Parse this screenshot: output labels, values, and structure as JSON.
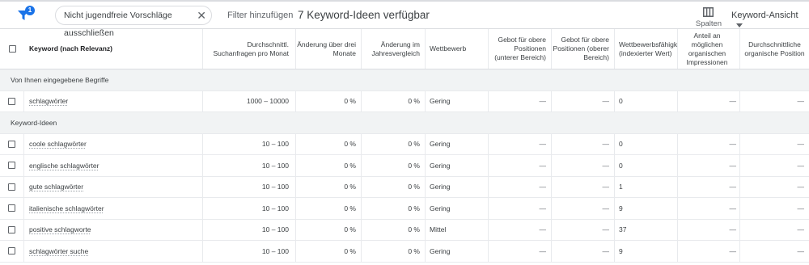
{
  "toolbar": {
    "filter_badge": "1",
    "chip_label": "Nicht jugendfreie Vorschläge ausschließen",
    "chip_close": "✕",
    "add_filter": "Filter hinzufügen",
    "ideas_count": "7 Keyword-Ideen verfügbar",
    "columns_label": "Spalten",
    "view_label": "Keyword-Ansicht"
  },
  "table": {
    "headers": [
      "Keyword (nach Relevanz)",
      "Durchschnittl. Suchanfragen pro Monat",
      "Änderung über drei Monate",
      "Änderung im Jahresvergleich",
      "Wettbewerb",
      "Gebot für obere Positionen (unterer Bereich)",
      "Gebot für obere Positionen (oberer Bereich)",
      "Wettbewerbsfähigk (indexierter Wert)",
      "Anteil an möglichen organischen Impressionen",
      "Durchschnittliche organische Position"
    ],
    "groups": [
      {
        "label": "Von Ihnen eingegebene Begriffe",
        "rows": [
          {
            "keyword": "schlagwörter",
            "searches": "1000 – 10000",
            "three_month": "0 %",
            "yoy": "0 %",
            "competition": "Gering",
            "bid_low": "—",
            "bid_high": "—",
            "comp_index": "0",
            "org_impr": "—",
            "org_pos": "—"
          }
        ]
      },
      {
        "label": "Keyword-Ideen",
        "rows": [
          {
            "keyword": "coole schlagwörter",
            "searches": "10 – 100",
            "three_month": "0 %",
            "yoy": "0 %",
            "competition": "Gering",
            "bid_low": "—",
            "bid_high": "—",
            "comp_index": "0",
            "org_impr": "—",
            "org_pos": "—"
          },
          {
            "keyword": "englische schlagwörter",
            "searches": "10 – 100",
            "three_month": "0 %",
            "yoy": "0 %",
            "competition": "Gering",
            "bid_low": "—",
            "bid_high": "—",
            "comp_index": "0",
            "org_impr": "—",
            "org_pos": "—"
          },
          {
            "keyword": "gute schlagwörter",
            "searches": "10 – 100",
            "three_month": "0 %",
            "yoy": "0 %",
            "competition": "Gering",
            "bid_low": "—",
            "bid_high": "—",
            "comp_index": "1",
            "org_impr": "—",
            "org_pos": "—"
          },
          {
            "keyword": "italienische schlagwörter",
            "searches": "10 – 100",
            "three_month": "0 %",
            "yoy": "0 %",
            "competition": "Gering",
            "bid_low": "—",
            "bid_high": "—",
            "comp_index": "9",
            "org_impr": "—",
            "org_pos": "—"
          },
          {
            "keyword": "positive schlagworte",
            "searches": "10 – 100",
            "three_month": "0 %",
            "yoy": "0 %",
            "competition": "Mittel",
            "bid_low": "—",
            "bid_high": "—",
            "comp_index": "37",
            "org_impr": "—",
            "org_pos": "—"
          },
          {
            "keyword": "schlagwörter suche",
            "searches": "10 – 100",
            "three_month": "0 %",
            "yoy": "0 %",
            "competition": "Gering",
            "bid_low": "—",
            "bid_high": "—",
            "comp_index": "9",
            "org_impr": "—",
            "org_pos": "—"
          }
        ]
      }
    ]
  }
}
